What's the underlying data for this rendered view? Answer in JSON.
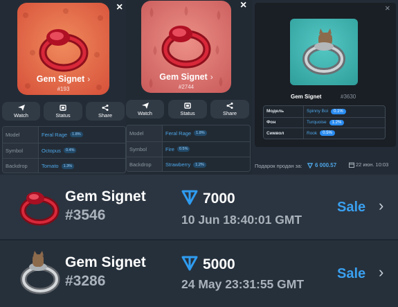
{
  "close_icon": "×",
  "cards": [
    {
      "name": "Gem Signet",
      "number": "#193",
      "chevron": "›",
      "bg": "#e46848"
    },
    {
      "name": "Gem Signet",
      "number": "#2744",
      "chevron": "›",
      "bg": "#d96f6a"
    }
  ],
  "actions": [
    {
      "label": "Watch",
      "icon": "paper-plane-icon"
    },
    {
      "label": "Status",
      "icon": "status-icon"
    },
    {
      "label": "Share",
      "icon": "share-icon"
    }
  ],
  "attr_tables": [
    {
      "rows": [
        {
          "key": "Model",
          "value": "Feral Rage",
          "pct": "1.8%"
        },
        {
          "key": "Symbol",
          "value": "Octopus",
          "pct": "0.4%"
        },
        {
          "key": "Backdrop",
          "value": "Tomato",
          "pct": "1.3%"
        }
      ]
    },
    {
      "rows": [
        {
          "key": "Model",
          "value": "Feral Rage",
          "pct": "1.8%"
        },
        {
          "key": "Symbol",
          "value": "Fire",
          "pct": "0.5%"
        },
        {
          "key": "Backdrop",
          "value": "Strawberry",
          "pct": "1.2%"
        }
      ]
    }
  ],
  "right_panel": {
    "name": "Gem Signet",
    "number": "#3630",
    "close": "×",
    "rows": [
      {
        "key": "Модель",
        "value": "Spinny Boi",
        "pct": "0.1%"
      },
      {
        "key": "Фон",
        "value": "Turquoise",
        "pct": "1.2%"
      },
      {
        "key": "Символ",
        "value": "Rook",
        "pct": "0.5%"
      }
    ],
    "sold_label": "Подарок продан за:",
    "sold_price": "6 000.57",
    "sold_date": "22 июн. 10:03",
    "bg": "#1a1f25",
    "card_bg": "#3fb0ae"
  },
  "listings": [
    {
      "title": "Gem Signet",
      "id": "#3546",
      "price": "7000",
      "date": "10 Jun 18:40:01 GMT",
      "sale": "Sale",
      "ring": "red",
      "bg": "#2b3541"
    },
    {
      "title": "Gem Signet",
      "id": "#3286",
      "price": "5000",
      "date": "24 May 23:31:55 GMT",
      "sale": "Sale",
      "ring": "silver",
      "bg": "#26303b"
    }
  ],
  "colors": {
    "accent": "#3aa0f0",
    "ton": "#2f9cf0",
    "panel_dark": "#1e252d"
  }
}
